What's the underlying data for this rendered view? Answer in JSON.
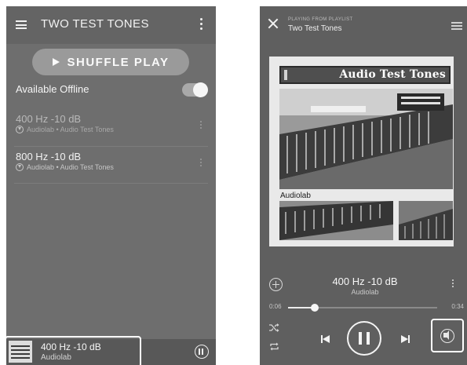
{
  "left_screen": {
    "title": "TWO TEST TONES",
    "shuffle_label": "SHUFFLE PLAY",
    "offline_label": "Available Offline",
    "offline_enabled": true,
    "tracks": [
      {
        "title": "400 Hz -10 dB",
        "subtitle": "Audiolab • Audio Test Tones",
        "downloaded": true
      },
      {
        "title": "800 Hz -10 dB",
        "subtitle": "Audiolab • Audio Test Tones",
        "downloaded": true
      }
    ],
    "mini_player": {
      "title": "400 Hz -10 dB",
      "artist": "Audiolab"
    }
  },
  "right_screen": {
    "playing_from": "PLAYING FROM PLAYLIST",
    "playlist_name": "Two Test Tones",
    "album_art": {
      "header_text": "Audio Test Tones",
      "label": "Audiolab"
    },
    "now_playing": {
      "title": "400 Hz -10 dB",
      "artist": "Audiolab"
    },
    "time_elapsed": "0:06",
    "time_total": "0:34",
    "progress_fraction": 0.18
  },
  "colors": {
    "accent_highlight": "#ffffff",
    "screen_bg": "#6e6e6e",
    "player_bg": "#5f5f5f"
  },
  "icons": [
    "menu-icon",
    "more-vertical-icon",
    "play-icon",
    "download-icon",
    "pause-icon",
    "close-icon",
    "queue-list-icon",
    "add-icon",
    "shuffle-icon",
    "repeat-icon",
    "skip-previous-icon",
    "skip-next-icon",
    "connect-device-icon"
  ]
}
